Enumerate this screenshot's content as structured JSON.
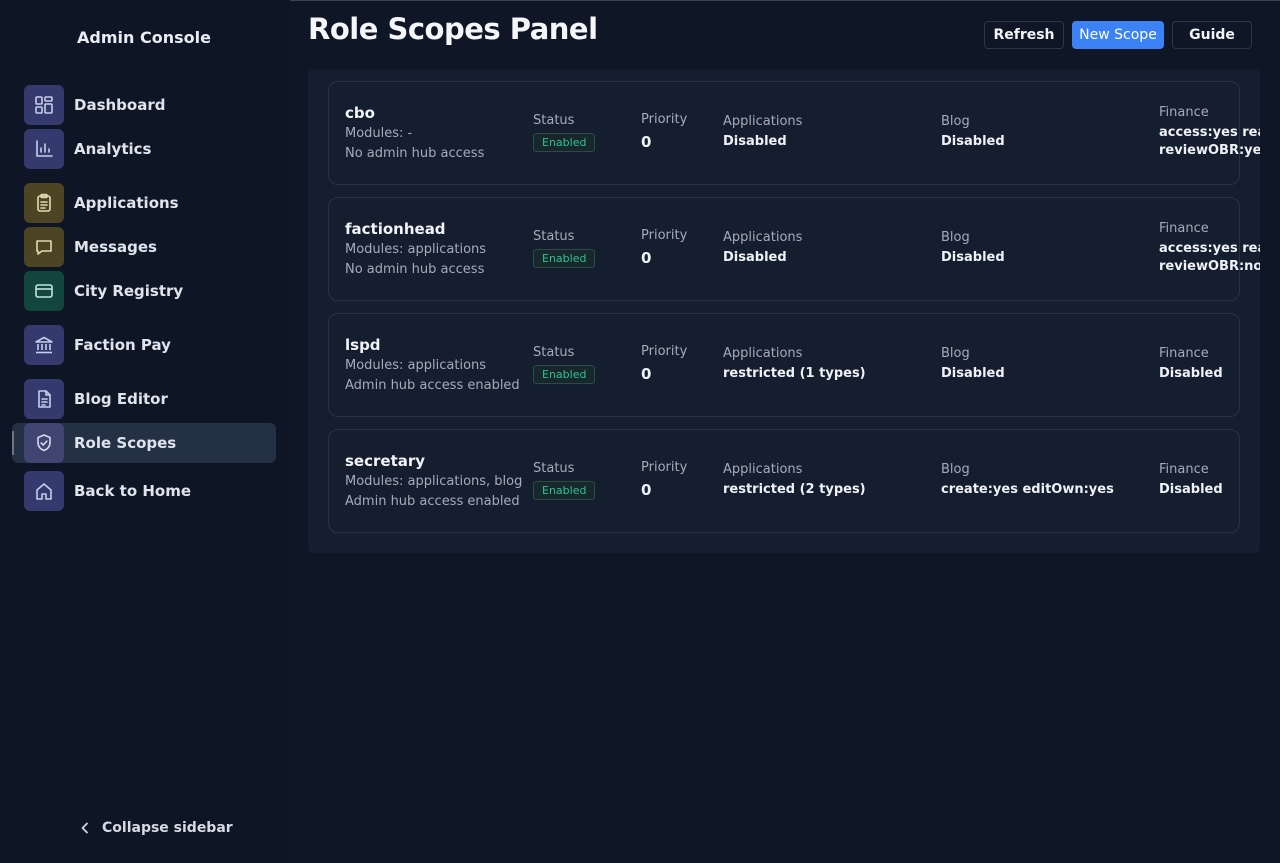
{
  "sidebar": {
    "title": "Admin Console",
    "items": [
      {
        "label": "Dashboard",
        "icon": "dashboard-icon"
      },
      {
        "label": "Analytics",
        "icon": "bar-chart-icon"
      },
      {
        "label": "Applications",
        "icon": "clipboard-icon"
      },
      {
        "label": "Messages",
        "icon": "message-icon"
      },
      {
        "label": "City Registry",
        "icon": "card-icon"
      },
      {
        "label": "Faction Pay",
        "icon": "bank-icon"
      },
      {
        "label": "Blog Editor",
        "icon": "document-icon"
      },
      {
        "label": "Role Scopes",
        "icon": "shield-check-icon",
        "active": true
      },
      {
        "label": "Back to Home",
        "icon": "home-icon"
      }
    ],
    "collapse_label": "Collapse sidebar"
  },
  "header": {
    "title": "Role Scopes Panel",
    "buttons": {
      "refresh": "Refresh",
      "new_scope": "New Scope",
      "guide": "Guide"
    }
  },
  "labels": {
    "status": "Status",
    "priority": "Priority",
    "applications": "Applications",
    "blog": "Blog",
    "finance": "Finance"
  },
  "scopes": [
    {
      "name": "cbo",
      "modules": "Modules: -",
      "access": "No admin hub access",
      "status": "Enabled",
      "priority": "0",
      "applications": "Disabled",
      "blog": "Disabled",
      "finance_line1": "access:yes read:yes",
      "finance_line2": "reviewOBR:yes"
    },
    {
      "name": "factionhead",
      "modules": "Modules: applications",
      "access": "No admin hub access",
      "status": "Enabled",
      "priority": "0",
      "applications": "Disabled",
      "blog": "Disabled",
      "finance_line1": "access:yes read:yes",
      "finance_line2": "reviewOBR:no"
    },
    {
      "name": "lspd",
      "modules": "Modules: applications",
      "access": "Admin hub access enabled",
      "status": "Enabled",
      "priority": "0",
      "applications": "restricted (1 types)",
      "blog": "Disabled",
      "finance_line1": "Disabled",
      "finance_line2": ""
    },
    {
      "name": "secretary",
      "modules": "Modules: applications, blog",
      "access": "Admin hub access enabled",
      "status": "Enabled",
      "priority": "0",
      "applications": "restricted (2 types)",
      "blog": "create:yes editOwn:yes",
      "finance_line1": "Disabled",
      "finance_line2": ""
    }
  ],
  "colors": {
    "accent": "#3b82f6",
    "status_enabled": "#2fc08f",
    "background": "#0f1626",
    "panel": "#151e2f"
  }
}
